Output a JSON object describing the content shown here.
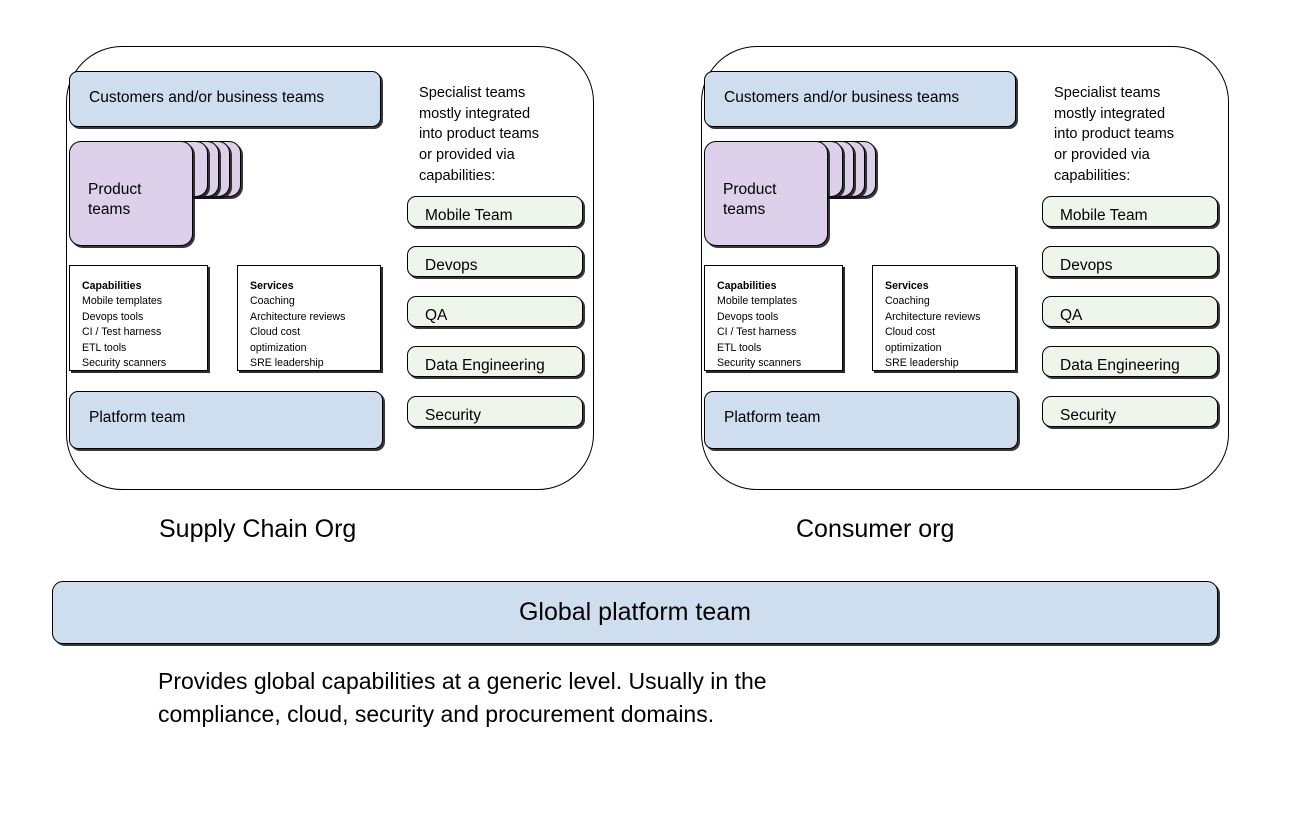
{
  "diagram": {
    "orgs": [
      {
        "caption": "Supply Chain Org",
        "customers_box": "Customers and/or business teams",
        "product_teams_label": "Product\nteams",
        "platform_team_label": "Platform team",
        "specialist_note": "Specialist teams\nmostly integrated\ninto product teams\nor provided via\ncapabilities:",
        "capabilities": {
          "title": "Capabilities",
          "items": [
            "Mobile templates",
            "Devops tools",
            "CI / Test harness",
            "ETL tools",
            "Security scanners"
          ]
        },
        "services": {
          "title": "Services",
          "items": [
            "Coaching",
            "Architecture reviews",
            "Cloud cost",
            "optimization",
            "SRE leadership"
          ]
        },
        "specialist_teams": [
          "Mobile Team",
          "Devops",
          "QA",
          "Data Engineering",
          "Security"
        ]
      },
      {
        "caption": "Consumer org",
        "customers_box": "Customers and/or business teams",
        "product_teams_label": "Product\nteams",
        "platform_team_label": "Platform team",
        "specialist_note": "Specialist teams\nmostly integrated\ninto product teams\nor provided via\ncapabilities:",
        "capabilities": {
          "title": "Capabilities",
          "items": [
            "Mobile templates",
            "Devops tools",
            "CI / Test harness",
            "ETL tools",
            "Security scanners"
          ]
        },
        "services": {
          "title": "Services",
          "items": [
            "Coaching",
            "Architecture reviews",
            "Cloud cost",
            "optimization",
            "SRE leadership"
          ]
        },
        "specialist_teams": [
          "Mobile Team",
          "Devops",
          "QA",
          "Data Engineering",
          "Security"
        ]
      }
    ],
    "global": {
      "bar_label": "Global platform team",
      "note": "Provides global capabilities at a generic level. Usually in the\ncompliance, cloud, security and procurement domains."
    },
    "colors": {
      "blue_fill": "#cfdeef",
      "purple_fill": "#dcd0ea",
      "green_fill": "#eef5ea",
      "stroke": "#000000",
      "page_background": "#ffffff"
    }
  }
}
